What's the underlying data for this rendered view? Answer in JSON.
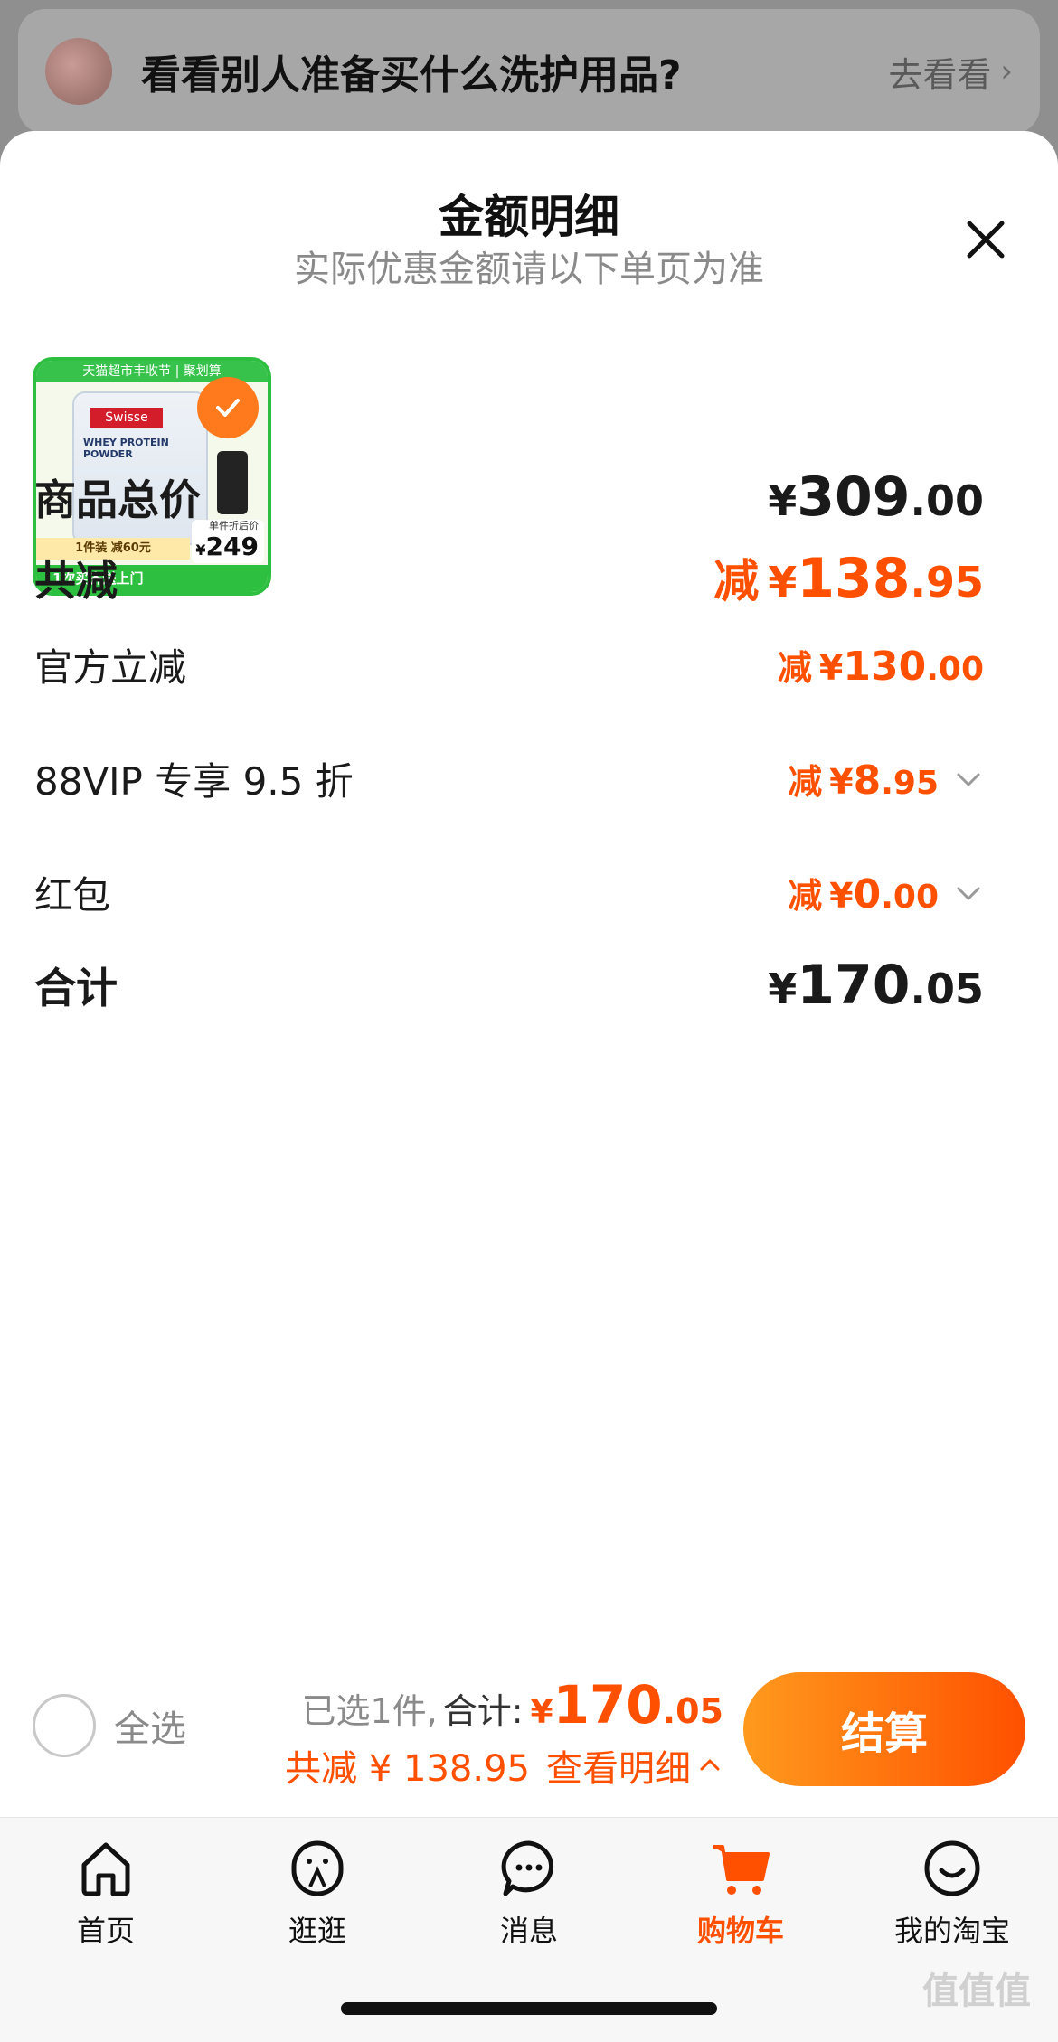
{
  "banner": {
    "text": "看看别人准备买什么洗护用品?",
    "link_label": "去看看"
  },
  "sheet": {
    "title": "金额明细",
    "subtitle": "实际优惠金额请以下单页为准"
  },
  "product": {
    "top_strip": "天猫超市丰收节 | 聚划算",
    "brand": "Swisse",
    "name": "WHEY PROTEIN POWDER",
    "promo": "1件装 减60元",
    "bottom_strip": "1次买齐送上门",
    "price_label": "单件折后价",
    "price_currency": "¥",
    "price_value": "249",
    "selected": true
  },
  "summary": {
    "goods_total": {
      "label": "商品总价",
      "currency": "¥",
      "int": "309",
      "dec": ".00"
    },
    "total_discount": {
      "label": "共减",
      "prefix": "减",
      "currency": "¥",
      "int": "138",
      "dec": ".95"
    },
    "official_discount": {
      "label": "官方立减",
      "prefix": "减",
      "currency": "¥",
      "int": "130",
      "dec": ".00"
    },
    "vip_discount": {
      "label": "88VIP 专享 9.5 折",
      "prefix": "减",
      "currency": "¥",
      "int": "8",
      "dec": ".95"
    },
    "red_packet": {
      "label": "红包",
      "prefix": "减",
      "currency": "¥",
      "int": "0",
      "dec": ".00"
    },
    "grand_total": {
      "label": "合计",
      "currency": "¥",
      "int": "170",
      "dec": ".05"
    }
  },
  "checkout": {
    "select_all_label": "全选",
    "selected_count": "已选1件,",
    "total_label": "合计:",
    "currency": "¥",
    "total_int": "170",
    "total_dec": ".05",
    "discount_line": "共减 ¥ 138.95",
    "detail_link": "查看明细",
    "button_label": "结算"
  },
  "tabs": [
    {
      "label": "首页",
      "icon": "home-icon"
    },
    {
      "label": "逛逛",
      "icon": "discover-icon"
    },
    {
      "label": "消息",
      "icon": "message-icon"
    },
    {
      "label": "购物车",
      "icon": "cart-icon",
      "active": true
    },
    {
      "label": "我的淘宝",
      "icon": "profile-icon"
    }
  ],
  "watermark": "值值值",
  "colors": {
    "accent": "#ff5000",
    "accent_gradient_start": "#ff9a1d"
  }
}
